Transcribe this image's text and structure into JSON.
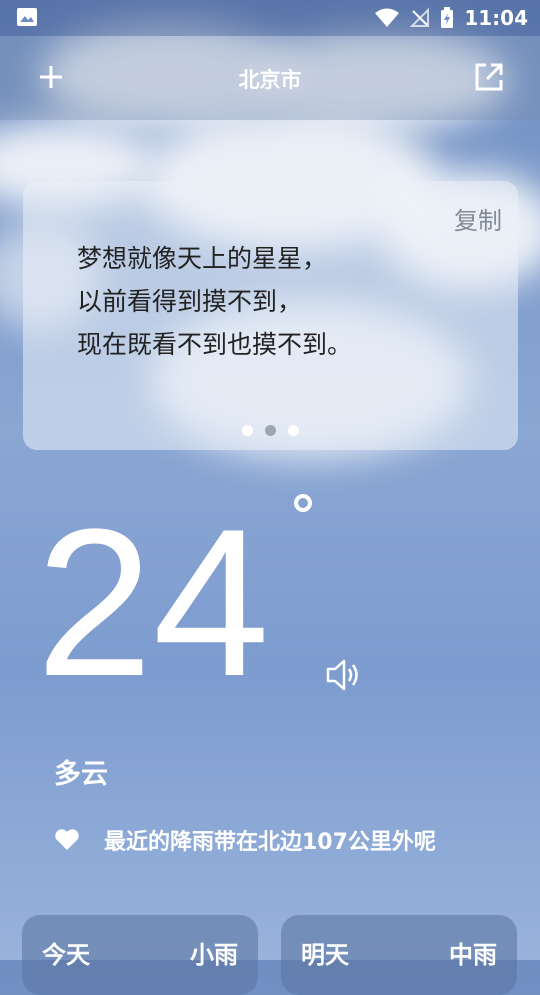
{
  "status": {
    "time": "11:04"
  },
  "appbar": {
    "city": "北京市"
  },
  "quote": {
    "copy_label": "复制",
    "lines": [
      "梦想就像天上的星星，",
      "以前看得到摸不到，",
      "现在既看不到也摸不到。"
    ],
    "page_count": 3,
    "active_page": 2
  },
  "weather": {
    "temperature": "24",
    "condition": "多云",
    "tip": "最近的降雨带在北边107公里外呢"
  },
  "forecast": [
    {
      "day": "今天",
      "condition": "小雨"
    },
    {
      "day": "明天",
      "condition": "中雨"
    }
  ],
  "icons": {
    "status_left": "image-icon",
    "wifi": "wifi-icon",
    "signal": "no-signal-icon",
    "battery": "battery-charging-icon",
    "add": "plus-icon",
    "share": "open-external-icon",
    "speaker": "speaker-icon",
    "heart": "heart-icon"
  }
}
